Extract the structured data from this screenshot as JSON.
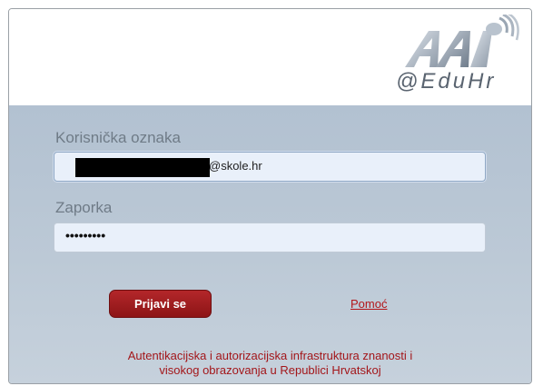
{
  "header": {
    "logo": {
      "icon": "aai-logo-icon",
      "tagline": "@EduHr"
    }
  },
  "form": {
    "username": {
      "label": "Korisnička oznaka",
      "value_suffix": "@skole.hr"
    },
    "password": {
      "label": "Zaporka",
      "value": "•••••••••"
    },
    "login_button": "Prijavi se",
    "help_link": "Pomoć"
  },
  "footer": {
    "line1": "Autentikacijska i autorizacijska infrastruktura znanosti i",
    "line2": "visokog obrazovanja u Republici Hrvatskoj"
  },
  "colors": {
    "accent_red": "#b3161a",
    "panel_blue": "#b8c6d4",
    "button_red": "#9e1c1f"
  }
}
